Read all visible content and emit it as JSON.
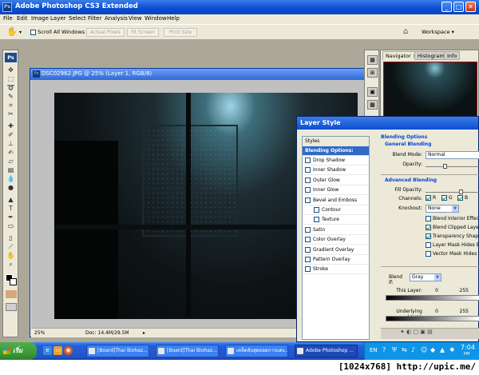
{
  "window": {
    "title": "Adobe Photoshop CS3 Extended",
    "app_icon": "Ps"
  },
  "menu": [
    "File",
    "Edit",
    "Image",
    "Layer",
    "Select",
    "Filter",
    "Analysis",
    "View",
    "Window",
    "Help"
  ],
  "options_bar": {
    "scroll_all_windows": "Scroll All Windows",
    "actual_pixels": "Actual Pixels",
    "fit_screen": "Fit Screen",
    "print_size": "Print Size",
    "workspace": "Workspace"
  },
  "tools": {
    "logo": "Ps"
  },
  "document": {
    "title": "DSC02962.JPG @ 25% (Layer 1, RGB/8)",
    "zoom": "25%",
    "doc_info": "Doc: 14.4M/29.5M"
  },
  "panels": {
    "tabs": [
      {
        "label": "Navigator",
        "close": "×"
      },
      {
        "label": "Histogram"
      },
      {
        "label": "Info"
      }
    ]
  },
  "layer_style": {
    "title": "Layer Style",
    "styles_header": "Styles",
    "selected_item": "Blending Options: Custom",
    "items": [
      {
        "label": "Drop Shadow",
        "checked": false,
        "sub": false
      },
      {
        "label": "Inner Shadow",
        "checked": false,
        "sub": false
      },
      {
        "label": "Outer Glow",
        "checked": false,
        "sub": false
      },
      {
        "label": "Inner Glow",
        "checked": false,
        "sub": false
      },
      {
        "label": "Bevel and Emboss",
        "checked": false,
        "sub": false
      },
      {
        "label": "Contour",
        "checked": false,
        "sub": true
      },
      {
        "label": "Texture",
        "checked": false,
        "sub": true
      },
      {
        "label": "Satin",
        "checked": false,
        "sub": false
      },
      {
        "label": "Color Overlay",
        "checked": false,
        "sub": false
      },
      {
        "label": "Gradient Overlay",
        "checked": false,
        "sub": false
      },
      {
        "label": "Pattern Overlay",
        "checked": false,
        "sub": false
      },
      {
        "label": "Stroke",
        "checked": false,
        "sub": false
      }
    ],
    "blending_options": "Blending Options",
    "general_blending": "General Blending",
    "blend_mode_label": "Blend Mode:",
    "blend_mode_value": "Normal",
    "opacity_label": "Opacity:",
    "advanced_blending": "Advanced Blending",
    "fill_opacity_label": "Fill Opacity:",
    "channels_label": "Channels:",
    "channel_r": "R",
    "channel_g": "G",
    "channel_b": "B",
    "knockout_label": "Knockout:",
    "knockout_value": "None",
    "advanced_checks": [
      {
        "label": "Blend Interior Effects a",
        "checked": false
      },
      {
        "label": "Blend Clipped Layers a",
        "checked": true
      },
      {
        "label": "Transparency Shapes",
        "checked": true
      },
      {
        "label": "Layer Mask Hides Effe",
        "checked": false
      },
      {
        "label": "Vector Mask Hides Effe",
        "checked": false
      }
    ],
    "blend_if_label": "Blend If:",
    "blend_if_value": "Gray",
    "this_layer_label": "This Layer:",
    "this_layer_min": "0",
    "this_layer_max": "255",
    "underlying_layer_label": "Underlying Layer:",
    "underlying_min": "0",
    "underlying_max": "255"
  },
  "taskbar": {
    "start": "เริ่ม",
    "tasks": [
      {
        "label": "[Board]Thai Biohaz...",
        "active": false
      },
      {
        "label": "[Board]Thai Biohaz...",
        "active": false
      },
      {
        "label": "เคล็ดลับสุดยอดการแต่ง...",
        "active": false
      },
      {
        "label": "Adobe Photoshop ...",
        "active": true
      }
    ],
    "lang": "EN",
    "clock": "7:04",
    "clock_suffix": "PM"
  },
  "footer": {
    "watermark": "[1024x768] http://upic.me/"
  },
  "colors": {
    "xp_blue": "#0b4fd6",
    "selection_blue": "#316ac5",
    "start_green": "#3a9b38",
    "ps_blue": "#1b4b8c"
  }
}
